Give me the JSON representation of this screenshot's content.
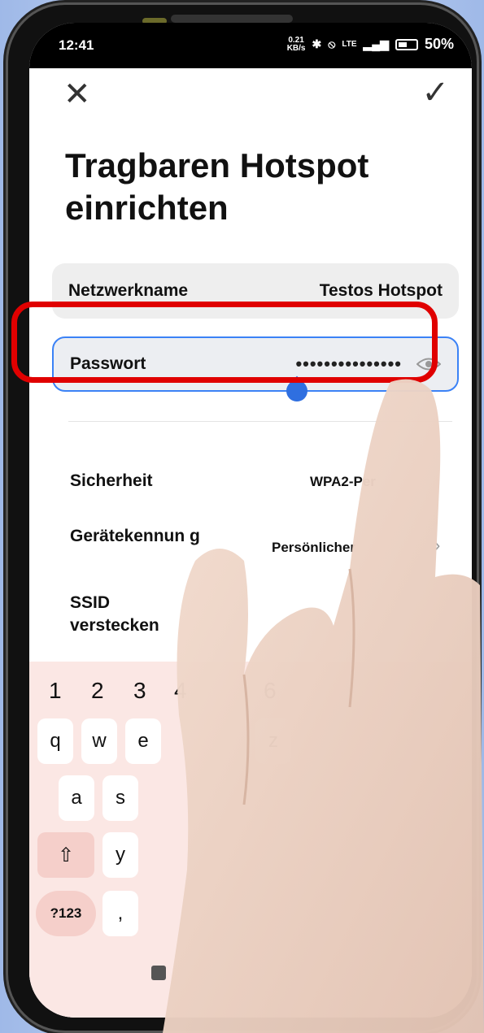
{
  "status": {
    "time": "12:41",
    "speed_value": "0.21",
    "speed_unit": "KB/s",
    "network_type": "LTE",
    "battery_percent": "50%"
  },
  "header": {
    "title": "Tragbaren Hotspot einrichten"
  },
  "fields": {
    "network_name_label": "Netzwerkname",
    "network_name_value": "Testos Hotspot",
    "password_label": "Passwort",
    "password_value": "•••••••••••••••"
  },
  "settings": {
    "security_label": "Sicherheit",
    "security_value": "WPA2-Per",
    "device_id_label": "Gerätekennun g",
    "device_id_value": "Persönlicher",
    "hide_ssid_label": "SSID verstecken"
  },
  "keyboard": {
    "numbers": [
      "1",
      "2",
      "3",
      "4",
      "6"
    ],
    "row1": [
      "q",
      "w",
      "e",
      "z"
    ],
    "row2": [
      "a",
      "s"
    ],
    "row3": [
      "y"
    ],
    "symbols_key": "?123",
    "comma_key": ","
  },
  "colors": {
    "accent": "#3b82f6",
    "highlight": "#e00000",
    "keyboard_bg": "#fbe7e4"
  }
}
